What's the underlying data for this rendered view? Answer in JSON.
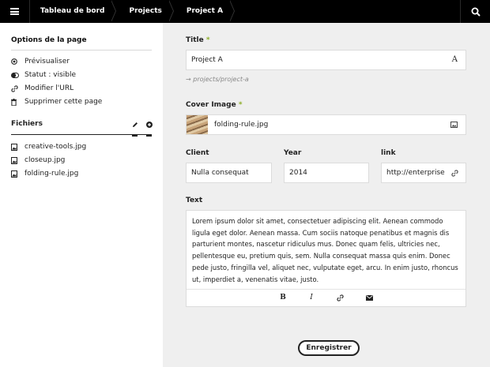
{
  "topbar": {
    "breadcrumbs": [
      "Tableau de bord",
      "Projects",
      "Project A"
    ],
    "menu_icon": "hamburger-icon",
    "search_icon": "search-icon"
  },
  "sidebar": {
    "options_title": "Options de la page",
    "options": [
      {
        "label": "Prévisualiser",
        "icon": "preview-icon"
      },
      {
        "label": "Statut : visible",
        "icon": "toggle-icon"
      },
      {
        "label": "Modifier l'URL",
        "icon": "link-icon"
      },
      {
        "label": "Supprimer cette page",
        "icon": "trash-icon"
      }
    ],
    "files_title": "Fichiers",
    "files": [
      {
        "name": "creative-tools.jpg",
        "icon": "image-file-icon"
      },
      {
        "name": "closeup.jpg",
        "icon": "image-file-icon"
      },
      {
        "name": "folding-rule.jpg",
        "icon": "image-file-icon"
      }
    ]
  },
  "form": {
    "title_label": "Title",
    "title_value": "Project A",
    "slug": "projects/project-a",
    "cover_label": "Cover Image",
    "cover_value": "folding-rule.jpg",
    "client_label": "Client",
    "client_value": "Nulla consequat",
    "year_label": "Year",
    "year_value": "2014",
    "link_label": "link",
    "link_value": "http://enterprise",
    "text_label": "Text",
    "text_value": "Lorem ipsum dolor sit amet, consectetuer adipiscing elit. Aenean commodo ligula eget dolor. Aenean massa. Cum sociis natoque penatibus et magnis dis parturient montes, nascetur ridiculus mus. Donec quam felis, ultricies nec, pellentesque eu, pretium quis, sem. Nulla consequat massa quis enim. Donec pede justo, fringilla vel, aliquet nec, vulputate eget, arcu. In enim justo, rhoncus ut, imperdiet a, venenatis vitae, justo.",
    "required_mark": "*",
    "toolbar": {
      "bold": "B",
      "italic": "I"
    },
    "save_label": "Enregistrer"
  },
  "colors": {
    "accent_required": "#8dae28",
    "topbar": "#000000"
  }
}
